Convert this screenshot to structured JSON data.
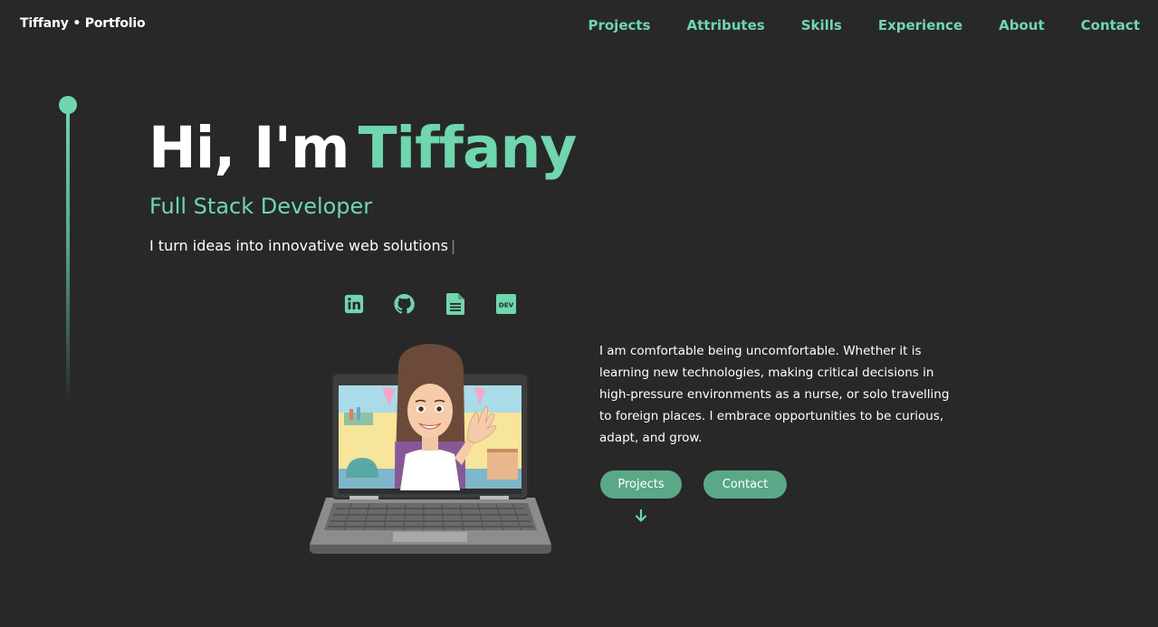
{
  "brand": "Tiffany • Portfolio",
  "nav": {
    "items": [
      {
        "label": "Projects"
      },
      {
        "label": "Attributes"
      },
      {
        "label": "Skills"
      },
      {
        "label": "Experience"
      },
      {
        "label": "About"
      },
      {
        "label": "Contact"
      }
    ]
  },
  "hero": {
    "greeting": "Hi, I'm",
    "name": "Tiffany",
    "role": "Full Stack Developer",
    "tagline": "I turn ideas into innovative web solutions",
    "cursor": "|"
  },
  "socials": [
    {
      "icon": "linkedin-icon"
    },
    {
      "icon": "github-icon"
    },
    {
      "icon": "resume-document-icon"
    },
    {
      "icon": "dev-icon",
      "text": "DEV"
    }
  ],
  "bio": "I am comfortable being uncomfortable. Whether it is learning new technologies, making critical decisions in high-pressure environments as a nurse, or solo travelling to foreign places. I embrace opportunities to be curious, adapt, and grow.",
  "buttons": {
    "projects": "Projects",
    "contact": "Contact"
  },
  "colors": {
    "background": "#282828",
    "accent": "#6fd6ad",
    "button": "#5aa888",
    "text": "#ffffff"
  }
}
